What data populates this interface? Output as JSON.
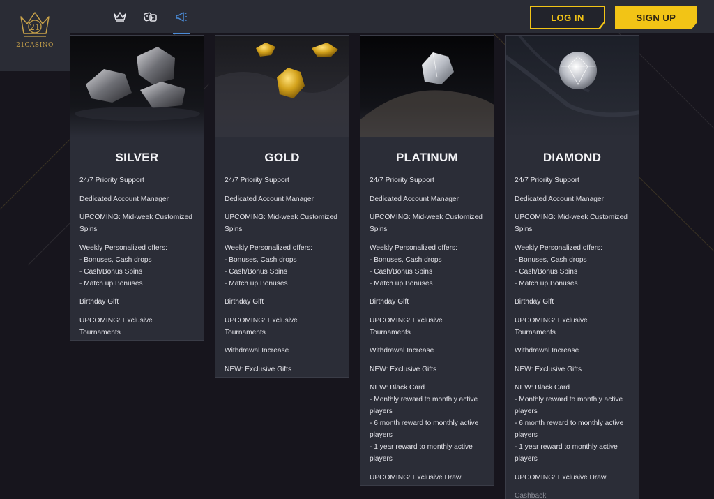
{
  "brand": {
    "name": "21CASINO"
  },
  "header": {
    "nav_icons": [
      "crown-icon",
      "dice-icon",
      "megaphone-icon"
    ],
    "active_nav": "megaphone-icon",
    "login_label": "LOG IN",
    "signup_label": "SIGN UP"
  },
  "colors": {
    "accent": "#f2c416",
    "card_bg": "#2b2d37",
    "page_bg": "#17151d",
    "active_tab": "#4a8bd8"
  },
  "tiers": [
    {
      "name": "SILVER",
      "image": "silver-ore-image",
      "benefits": [
        "24/7 Priority Support",
        "Dedicated Account Manager",
        "UPCOMING: Mid-week Customized\nSpins",
        "Weekly Personalized offers:\n- Bonuses, Cash drops\n- Cash/Bonus Spins\n- Match up Bonuses",
        "Birthday Gift",
        "UPCOMING: Exclusive Tournaments"
      ]
    },
    {
      "name": "GOLD",
      "image": "gold-nugget-image",
      "benefits": [
        "24/7 Priority Support",
        "Dedicated Account Manager",
        "UPCOMING: Mid-week Customized\nSpins",
        "Weekly Personalized offers:\n- Bonuses, Cash drops\n- Cash/Bonus Spins\n- Match up Bonuses",
        "Birthday Gift",
        "UPCOMING: Exclusive Tournaments",
        "Withdrawal Increase",
        "NEW: Exclusive Gifts"
      ]
    },
    {
      "name": "PLATINUM",
      "image": "platinum-crystal-image",
      "benefits": [
        "24/7 Priority Support",
        "Dedicated Account Manager",
        "UPCOMING: Mid-week Customized\nSpins",
        "Weekly Personalized offers:\n- Bonuses, Cash drops\n- Cash/Bonus Spins\n- Match up Bonuses",
        "Birthday Gift",
        "UPCOMING: Exclusive Tournaments",
        "Withdrawal Increase",
        "NEW: Exclusive Gifts",
        "NEW: Black Card\n- Monthly reward to monthly active\nplayers\n- 6 month reward to monthly active\nplayers\n- 1 year reward to monthly active\nplayers",
        "UPCOMING: Exclusive Draw"
      ]
    },
    {
      "name": "DIAMOND",
      "image": "diamond-image",
      "benefits": [
        "24/7 Priority Support",
        "Dedicated Account Manager",
        "UPCOMING: Mid-week Customized\nSpins",
        "Weekly Personalized offers:\n- Bonuses, Cash drops\n- Cash/Bonus Spins\n- Match up Bonuses",
        "Birthday Gift",
        "UPCOMING: Exclusive Tournaments",
        "Withdrawal Increase",
        "NEW: Exclusive Gifts",
        "NEW: Black Card\n- Monthly reward to monthly active\nplayers\n- 6 month reward to monthly active\nplayers\n- 1 year reward to monthly active\nplayers",
        "UPCOMING: Exclusive Draw",
        "Cashback"
      ]
    }
  ]
}
